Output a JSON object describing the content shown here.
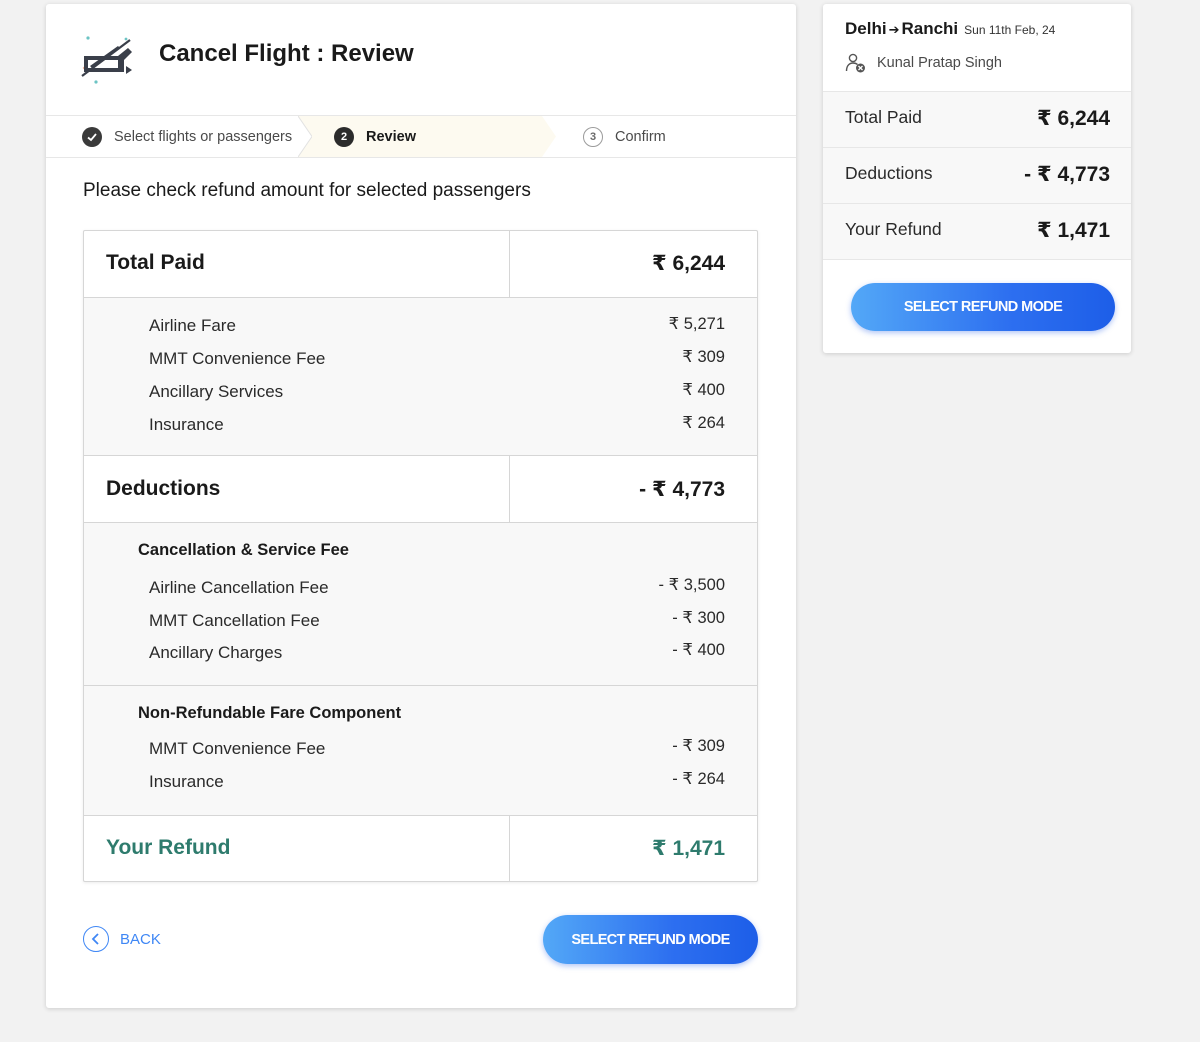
{
  "header": {
    "title": "Cancel Flight : Review"
  },
  "stepper": {
    "steps": [
      {
        "number": "1",
        "label": "Select flights or passengers",
        "status": "done"
      },
      {
        "number": "2",
        "label": "Review",
        "status": "active"
      },
      {
        "number": "3",
        "label": "Confirm",
        "status": "pending"
      }
    ]
  },
  "instruction": "Please check refund amount for selected passengers",
  "table": {
    "total_paid": {
      "label": "Total Paid",
      "amount": "₹ 6,244",
      "items": [
        {
          "label": "Airline Fare",
          "amount": "₹ 5,271"
        },
        {
          "label": "MMT Convenience Fee",
          "amount": "₹ 309"
        },
        {
          "label": "Ancillary Services",
          "amount": "₹ 400"
        },
        {
          "label": "Insurance",
          "amount": "₹ 264"
        }
      ]
    },
    "deductions": {
      "label": "Deductions",
      "amount": "- ₹ 4,773",
      "groups": [
        {
          "title": "Cancellation & Service Fee",
          "items": [
            {
              "label": "Airline Cancellation Fee",
              "amount": "- ₹ 3,500"
            },
            {
              "label": "MMT Cancellation Fee",
              "amount": "- ₹ 300"
            },
            {
              "label": "Ancillary Charges",
              "amount": "- ₹ 400"
            }
          ]
        },
        {
          "title": "Non-Refundable Fare Component",
          "items": [
            {
              "label": "MMT Convenience Fee",
              "amount": "- ₹ 309"
            },
            {
              "label": "Insurance",
              "amount": "- ₹ 264"
            }
          ]
        }
      ]
    },
    "refund": {
      "label": "Your Refund",
      "amount": "₹ 1,471"
    }
  },
  "actions": {
    "back_label": "BACK",
    "select_refund_mode_label": "SELECT REFUND MODE"
  },
  "summary": {
    "origin": "Delhi",
    "destination": "Ranchi",
    "date": "Sun 11th Feb, 24",
    "passenger": "Kunal Pratap Singh",
    "total_paid_label": "Total Paid",
    "total_paid_amount": "₹ 6,244",
    "deductions_label": "Deductions",
    "deductions_amount": "- ₹ 4,773",
    "refund_label": "Your Refund",
    "refund_amount": "₹ 1,471",
    "button_label": "SELECT REFUND MODE"
  },
  "colors": {
    "accent_blue": "#3f87f5",
    "refund_green": "#2e7b6d",
    "active_step_bg": "#fdfaf0"
  }
}
